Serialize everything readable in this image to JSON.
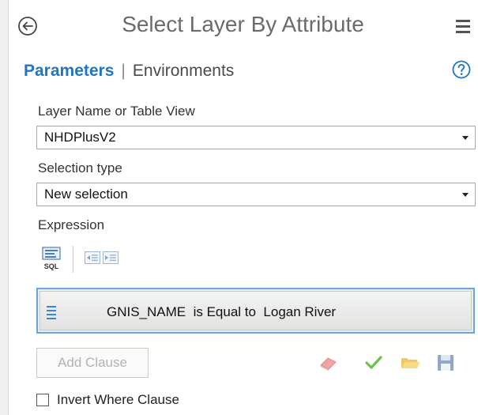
{
  "header": {
    "title": "Select Layer By Attribute",
    "back_icon": "back-arrow-circle-icon",
    "menu_icon": "hamburger-menu-icon"
  },
  "tabs": {
    "parameters": "Parameters",
    "separator": "|",
    "environments": "Environments",
    "help_icon": "help-question-icon"
  },
  "form": {
    "layer_label": "Layer Name or Table View",
    "layer_value": "NHDPlusV2",
    "selection_label": "Selection type",
    "selection_value": "New selection",
    "expression_label": "Expression"
  },
  "expression_tools": {
    "sql_icon": "sql-icon",
    "sql_text": "SQL",
    "outdent_icon": "outdent-icon",
    "indent_icon": "indent-icon"
  },
  "clause": {
    "text": "GNIS_NAME  is Equal to  Logan River"
  },
  "actions": {
    "add_clause": "Add Clause",
    "eraser_icon": "eraser-icon",
    "verify_icon": "checkmark-verify-icon",
    "open_icon": "folder-open-icon",
    "save_icon": "save-disk-icon"
  },
  "invert": {
    "label": "Invert Where Clause",
    "checked": false
  },
  "colors": {
    "accent": "#1f76c1",
    "clause_border": "#6aa6dc",
    "disabled_text": "#b2b2b2"
  }
}
